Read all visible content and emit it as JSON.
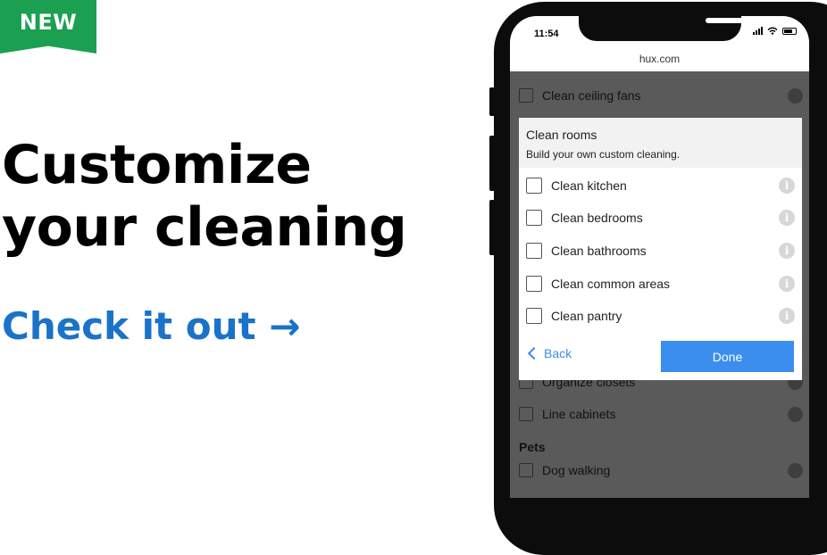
{
  "badge": "NEW",
  "hero": {
    "line1": "Customize",
    "line2": "your cleaning"
  },
  "cta": {
    "label": "Check it out →"
  },
  "phone": {
    "time": "11:54",
    "url": "hux.com",
    "background_items": [
      {
        "label": "Clean ceiling fans"
      },
      {
        "label": "Organize closets"
      },
      {
        "label": "Line cabinets"
      }
    ],
    "section_pets": "Pets",
    "pets_items": [
      {
        "label": "Dog walking"
      }
    ],
    "modal": {
      "title": "Clean rooms",
      "subtitle": "Build your own custom cleaning.",
      "options": [
        {
          "label": "Clean kitchen",
          "checked": false
        },
        {
          "label": "Clean bedrooms",
          "checked": false
        },
        {
          "label": "Clean bathrooms",
          "checked": false
        },
        {
          "label": "Clean common areas",
          "checked": false
        },
        {
          "label": "Clean pantry",
          "checked": false
        }
      ],
      "info_glyph": "i",
      "back_label": "Back",
      "done_label": "Done"
    }
  },
  "colors": {
    "brand_green": "#1aa050",
    "cta_blue": "#1a73c8",
    "button_blue": "#3b8eed",
    "overlay": "#5a5a5a"
  }
}
